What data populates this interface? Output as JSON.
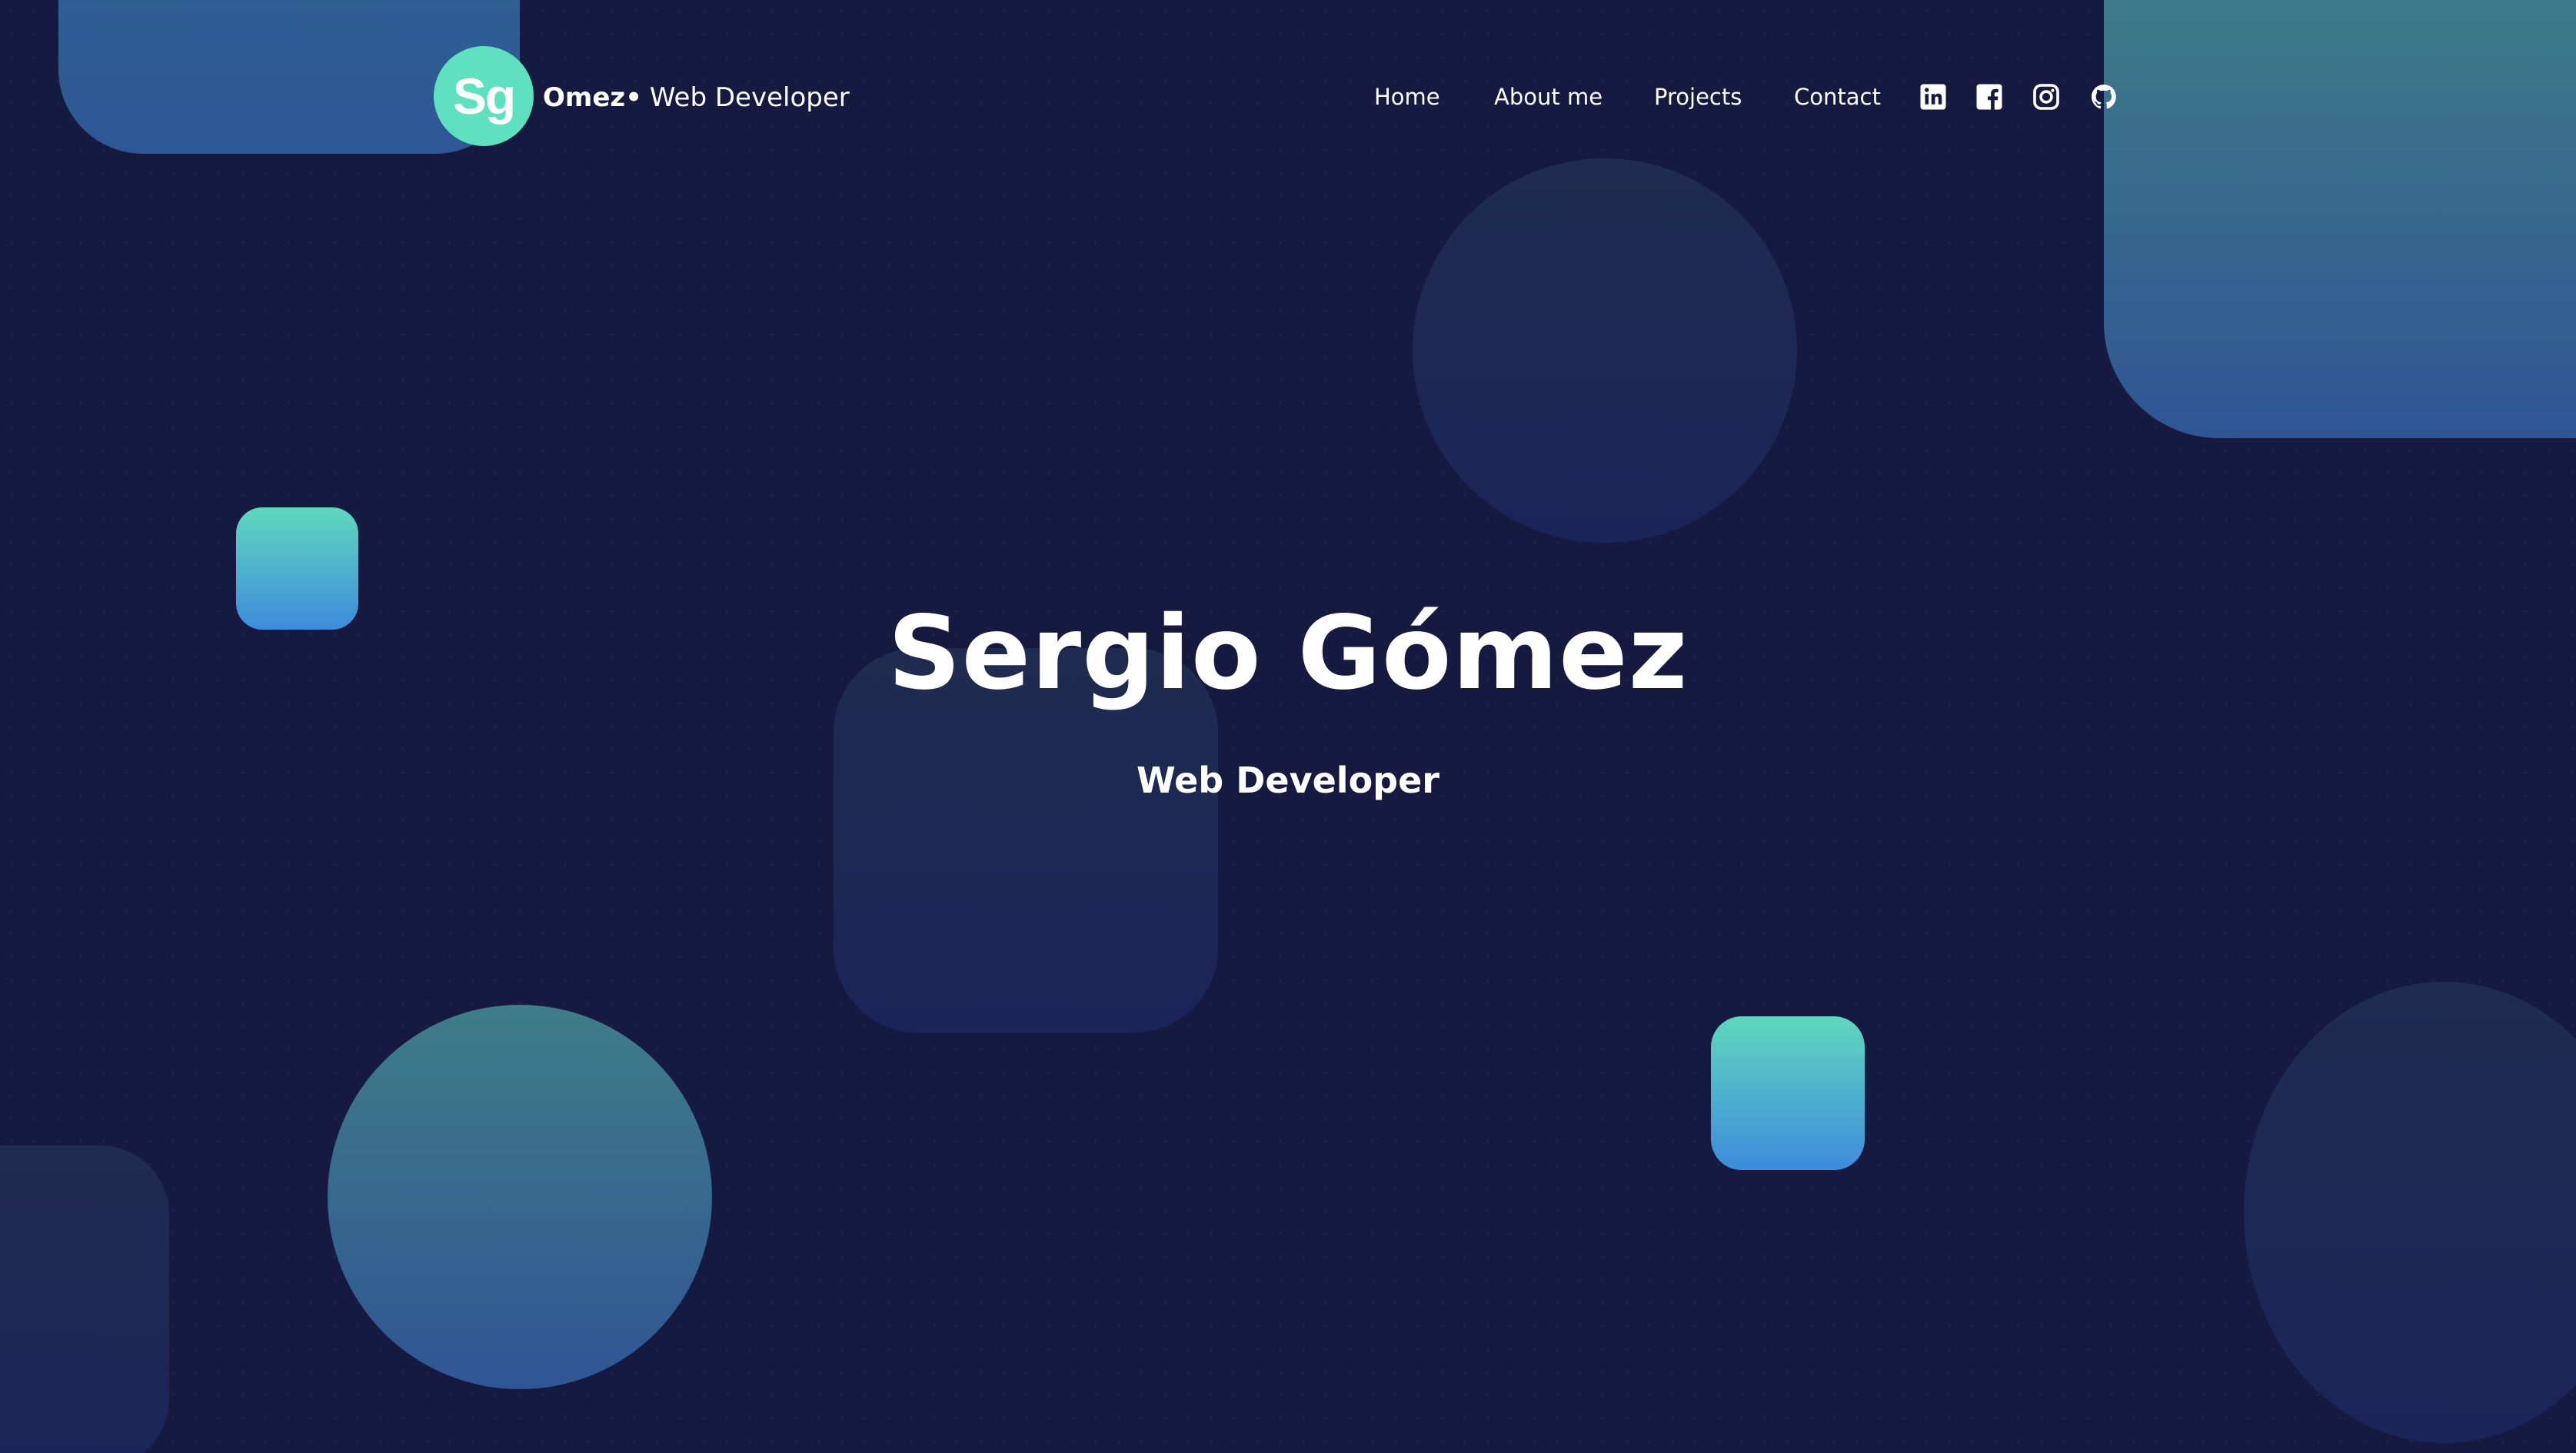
{
  "colors": {
    "background": "#171a40",
    "accent_teal": "#5fe0bf",
    "accent_blue": "#3e8bdc",
    "text": "#ffffff"
  },
  "header": {
    "logo_initials": "Sg",
    "brand_name": "Omez",
    "brand_separator": "•",
    "brand_role": "Web Developer"
  },
  "nav": {
    "items": [
      {
        "label": "Home"
      },
      {
        "label": "About me"
      },
      {
        "label": "Projects"
      },
      {
        "label": "Contact"
      }
    ],
    "social_icons": [
      "linkedin-icon",
      "facebook-icon",
      "instagram-icon",
      "github-icon"
    ]
  },
  "hero": {
    "title": "Sergio Gómez",
    "subtitle": "Web Developer"
  }
}
